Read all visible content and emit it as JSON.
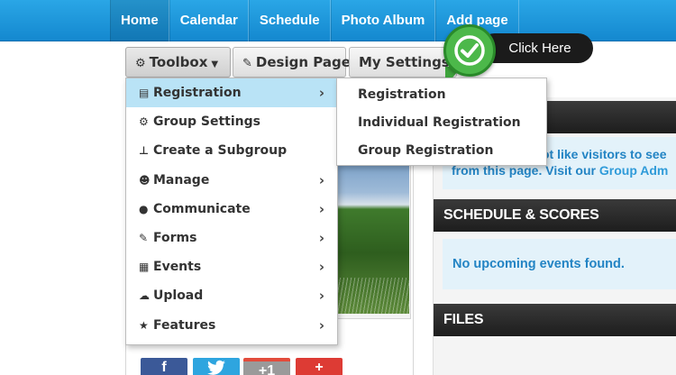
{
  "topnav": {
    "items": [
      {
        "label": "Home",
        "active": true
      },
      {
        "label": "Calendar"
      },
      {
        "label": "Schedule"
      },
      {
        "label": "Photo Album"
      },
      {
        "label": "Add page"
      }
    ]
  },
  "toolbar": {
    "toolbox_label": "Toolbox",
    "design_label": "Design Page",
    "settings_label": "My Settings"
  },
  "callout": {
    "label": "Click Here",
    "badge_color": "#4cb84a"
  },
  "toolbox_menu": {
    "items": [
      {
        "label": "Registration",
        "icon": "id-card-icon"
      },
      {
        "label": "Group Settings",
        "icon": "gear-icon"
      },
      {
        "label": "Create a Subgroup",
        "icon": "sitemap-icon"
      },
      {
        "label": "Manage",
        "icon": "users-icon"
      },
      {
        "label": "Communicate",
        "icon": "comments-icon"
      },
      {
        "label": "Forms",
        "icon": "edit-icon"
      },
      {
        "label": "Events",
        "icon": "calendar-icon"
      },
      {
        "label": "Upload",
        "icon": "cloud-upload-icon"
      },
      {
        "label": "Features",
        "icon": "star-icon"
      }
    ],
    "active_color": "#b9e3f6"
  },
  "registration_submenu": {
    "items": [
      {
        "label": "Registration"
      },
      {
        "label": "Individual Registration"
      },
      {
        "label": "Group Registration"
      }
    ]
  },
  "right_column": {
    "visitors_line1": "ot like visitors to see",
    "visitors_line2_prefix": "from this page. Visit our",
    "visitors_link": "Group Adm",
    "schedule_heading": "SCHEDULE & SCORES",
    "no_events": "No upcoming events found.",
    "files_heading": "FILES"
  },
  "social": {
    "facebook": "f",
    "google_plus": "+1",
    "add": "+"
  },
  "colors": {
    "nav_blue": "#1a93d9",
    "link_blue": "#2384c4"
  }
}
